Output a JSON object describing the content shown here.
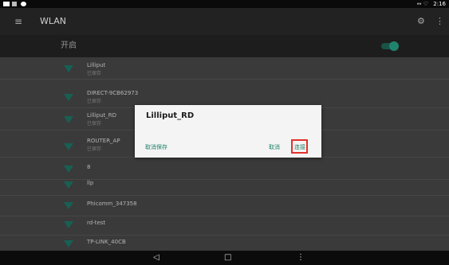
{
  "status_bar": {
    "time": "2:16",
    "icons": "↔ ♡"
  },
  "app_bar": {
    "title": "WLAN"
  },
  "switch": {
    "label": "开启",
    "on": true
  },
  "networks": [
    {
      "name": "Lilliput",
      "status": "已保存"
    },
    {
      "name": "DIRECT-9CB62973",
      "status": "已保存"
    },
    {
      "name": "Lilliput_RD",
      "status": "已保存"
    },
    {
      "name": "ROUTER_AP",
      "status": "已保存"
    },
    {
      "name": "8",
      "status": ""
    },
    {
      "name": "llp",
      "status": ""
    },
    {
      "name": "Phicomm_347358",
      "status": ""
    },
    {
      "name": "rd-test",
      "status": ""
    },
    {
      "name": "TP-LINK_40CB",
      "status": ""
    }
  ],
  "dialog": {
    "title": "Lilliput_RD",
    "forget_label": "取消保存",
    "cancel_label": "取消",
    "connect_label": "连接"
  },
  "nav_bar": {
    "back": "◁",
    "home": "□",
    "menu": "⋮"
  },
  "colors": {
    "accent": "#1e7f68",
    "highlight": "#e0322c",
    "wifi": "#1f7b6b"
  }
}
